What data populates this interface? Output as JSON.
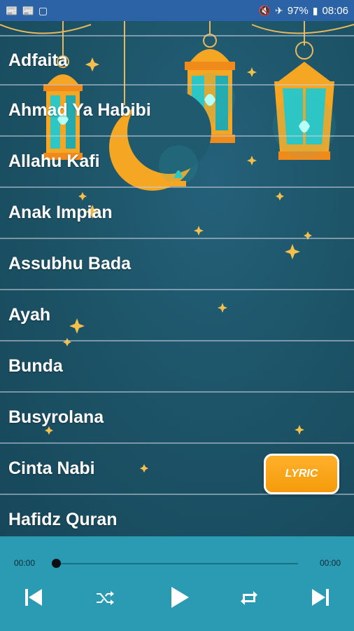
{
  "status_bar": {
    "left_icons": [
      "notification-icon",
      "notification-icon",
      "screenshot-icon"
    ],
    "battery": "97%",
    "time": "08:06"
  },
  "songs": [
    "Adfaita",
    "Ahmad Ya Habibi",
    "Allahu Kafi",
    "Anak Impian",
    "Assubhu Bada",
    "Ayah",
    "Bunda",
    "Busyrolana",
    "Cinta Nabi",
    "Hafidz Quran"
  ],
  "lyric_button": "LYRIC",
  "player": {
    "current_time": "00:00",
    "total_time": "00:00",
    "progress": 0
  },
  "colors": {
    "status_bar": "#2b63a6",
    "player_bg": "#2a9bb3",
    "lyric_button": "#f7a01a",
    "lantern_gold": "#f5a623",
    "lantern_glass": "#2ec7c4"
  }
}
